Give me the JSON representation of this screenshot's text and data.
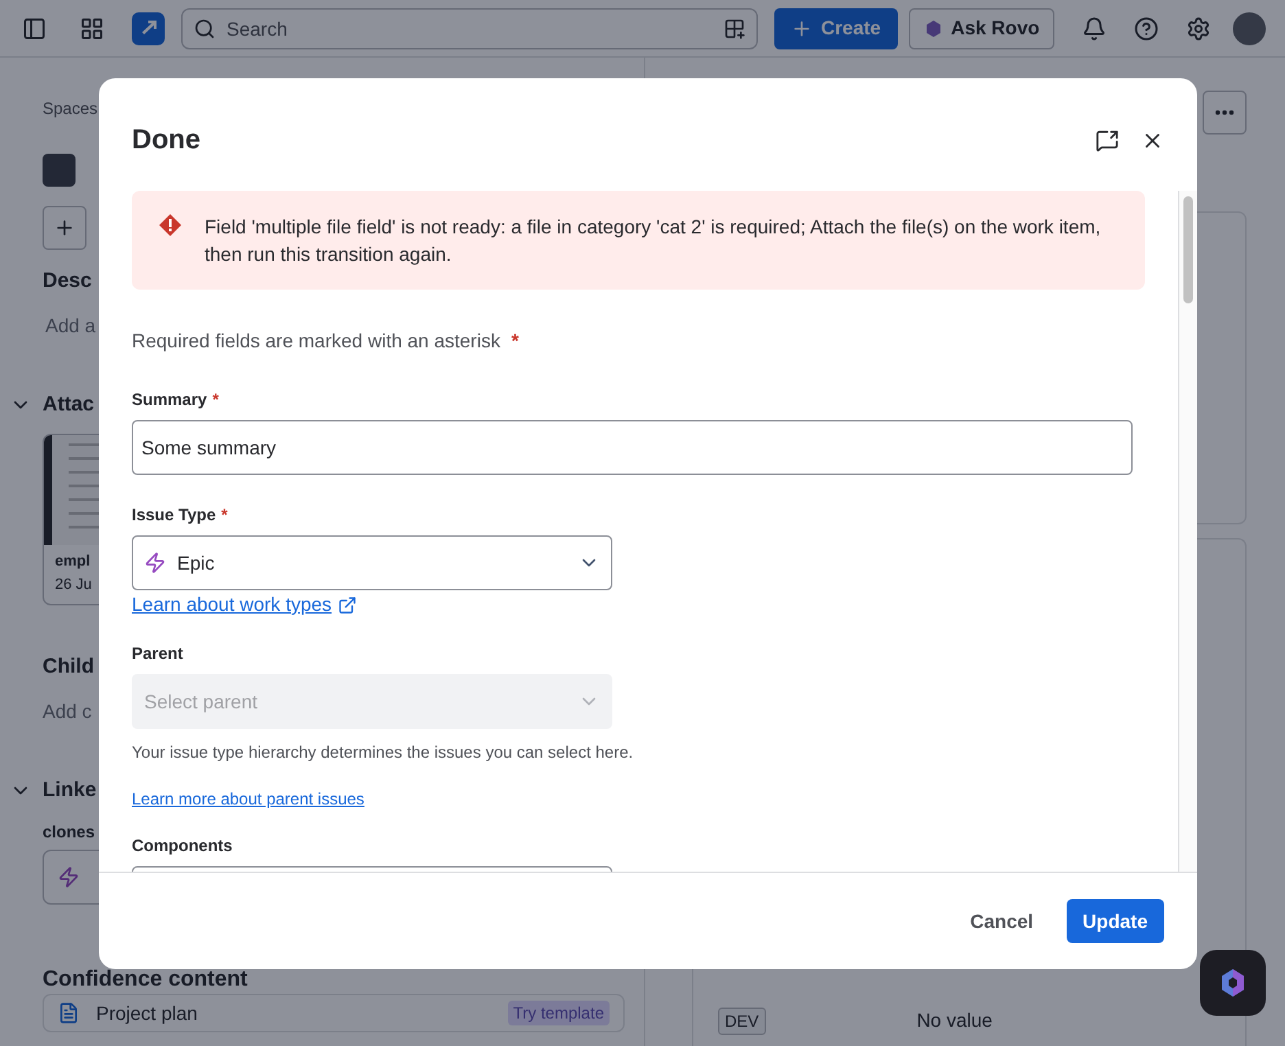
{
  "topbar": {
    "search": {
      "placeholder": "Search"
    },
    "create_button": "Create",
    "rovo_button": "Ask Rovo"
  },
  "page": {
    "breadcrumb": "Spaces",
    "description": {
      "heading": "Desc",
      "placeholder": "Add a"
    },
    "attachments": {
      "heading": "Attac",
      "expanded": true,
      "file_name": "empl",
      "file_date": "26 Ju"
    },
    "child": {
      "heading": "Child",
      "placeholder": "Add c"
    },
    "linked": {
      "heading": "Linke",
      "expanded": true,
      "relation": "clones"
    },
    "content": {
      "heading": "Confidence content",
      "item": "Project plan",
      "badge": "Try template"
    },
    "details": {
      "badge": "DEV",
      "value": "No value"
    }
  },
  "dialog": {
    "title": "Done",
    "error": "Field 'multiple file field' is not ready: a file in category 'cat 2' is required; Attach the file(s) on the work item, then run this transition again.",
    "required_note": "Required fields are marked with an asterisk",
    "required_note_mark": "*",
    "fields": [
      {
        "kind": "text",
        "label": "Summary",
        "required_mark": "*",
        "value": "Some summary"
      },
      {
        "kind": "select",
        "label": "Issue Type",
        "required_mark": "*",
        "value": "Epic",
        "disabled": false,
        "link": "Learn about work types",
        "link_external": true
      },
      {
        "kind": "select",
        "label": "Parent",
        "disabled": true,
        "placeholder": "Select parent",
        "help": "Your issue type hierarchy determines the issues you can select here.",
        "link": "Learn more about parent issues",
        "link_external": false
      },
      {
        "kind": "select",
        "label": "Components"
      }
    ],
    "cancel_button": "Cancel",
    "submit_button": "Update"
  }
}
